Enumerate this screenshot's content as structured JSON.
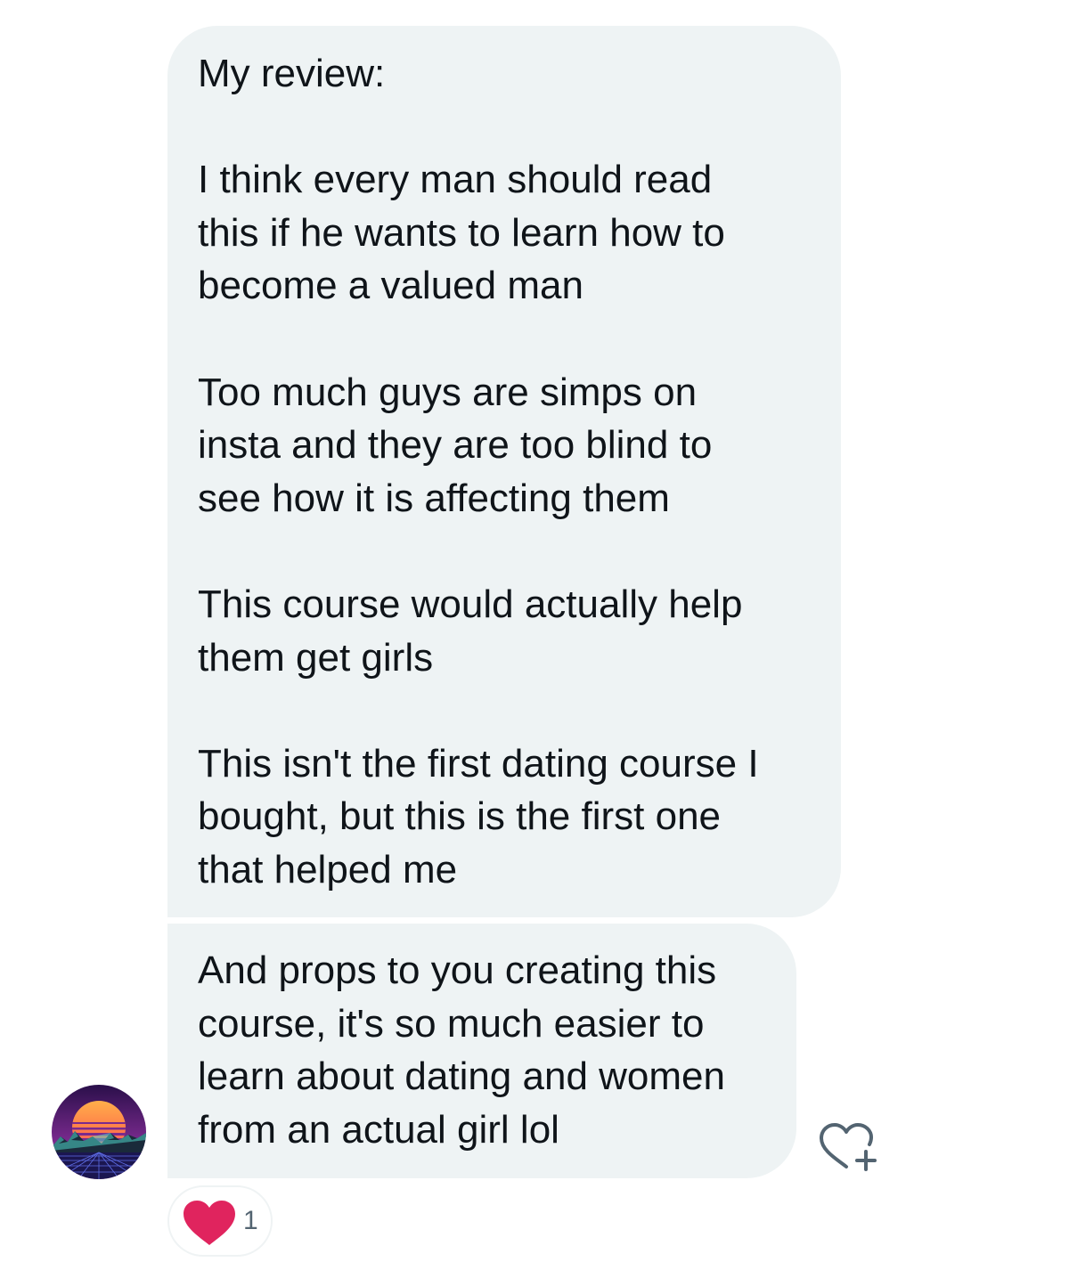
{
  "messages": [
    {
      "paragraphs": [
        [
          "My review:"
        ],
        [
          "I think every man should read",
          "this if he wants to learn how to",
          "become a valued man"
        ],
        [
          "Too much guys are simps on",
          "insta and they are too blind to",
          "see how it is affecting them"
        ],
        [
          "This course would actually help",
          "them get girls"
        ],
        [
          "This isn't the first dating course I",
          "bought, but this is the first one",
          "that helped me"
        ]
      ]
    },
    {
      "paragraphs": [
        [
          "And props to you creating this",
          "course, it's so much easier to",
          "learn about dating and women",
          "from an actual girl lol"
        ]
      ]
    }
  ],
  "reaction": {
    "icon": "heart-icon",
    "count": "1",
    "color": "#e0245e"
  },
  "like_button": {
    "icon": "heart-plus-icon",
    "color": "#536471"
  },
  "colors": {
    "bubble": "#eef3f4",
    "text": "#0f1419"
  }
}
